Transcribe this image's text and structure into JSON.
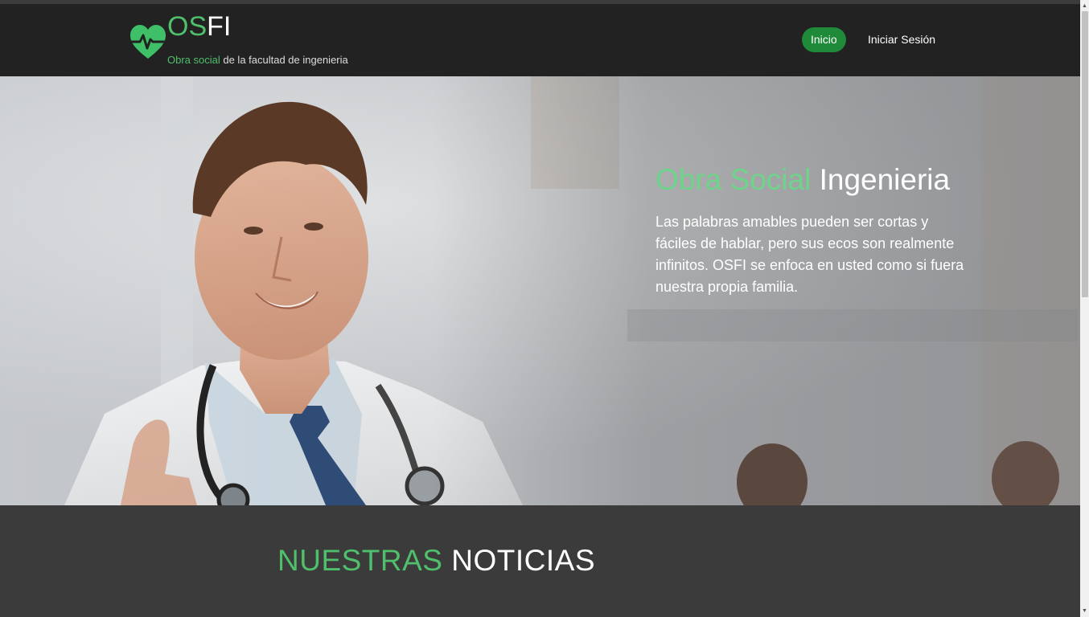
{
  "navbar": {
    "brand": {
      "part1": "OS",
      "part2": "FI"
    },
    "tagline": {
      "highlight": "Obra social",
      "rest": " de la facultad de ingenieria"
    },
    "items": [
      {
        "label": "Inicio"
      },
      {
        "label": "Iniciar Sesión"
      }
    ],
    "active_color": "#1f8a3a"
  },
  "hero": {
    "title": {
      "highlight": "Obra Social",
      "rest": " Ingenieria"
    },
    "text": "Las palabras amables pueden ser cortas y fáciles de hablar, pero sus ecos son realmente infinitos. OSFI se enfoca en usted como si fuera nuestra propia familia."
  },
  "news": {
    "title": {
      "highlight": "NUESTRAS",
      "rest": " NOTICIAS"
    }
  },
  "colors": {
    "accent_green": "#4fbf6c",
    "navbar_bg": "#222222",
    "section_bg": "#3b3b3b"
  },
  "icons": {
    "logo": "heart-pulse-icon",
    "scroll_up": "arrow-up-icon",
    "scroll_down": "arrow-down-icon"
  }
}
